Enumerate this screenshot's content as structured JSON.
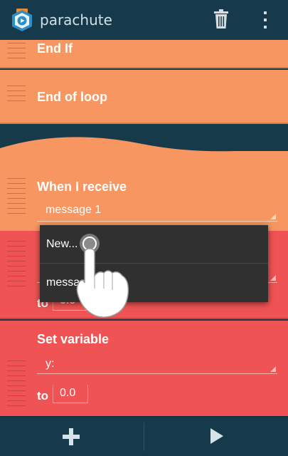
{
  "app": {
    "title": "parachute"
  },
  "colors": {
    "actionbar": "#163a4c",
    "control_brick": "#f79660",
    "variable_brick": "#f05353",
    "popup": "#303030"
  },
  "icons": {
    "app": "parachute-app-icon",
    "delete": "trash-icon",
    "menu": "overflow-menu-icon",
    "add": "plus-icon",
    "run": "play-icon",
    "touch": "pointing-hand-icon"
  },
  "bricks": [
    {
      "type": "control",
      "label": "End If"
    },
    {
      "type": "control",
      "label": "End of loop"
    },
    {
      "type": "event",
      "label": "When I receive",
      "value": "message 1"
    },
    {
      "type": "variable",
      "to_label": "to",
      "value": "0.0"
    },
    {
      "type": "variable",
      "label": "Set variable",
      "variable": "y:",
      "to_label": "to",
      "value": "0.0"
    }
  ],
  "popup": {
    "items": [
      "New...",
      "message 1"
    ]
  }
}
